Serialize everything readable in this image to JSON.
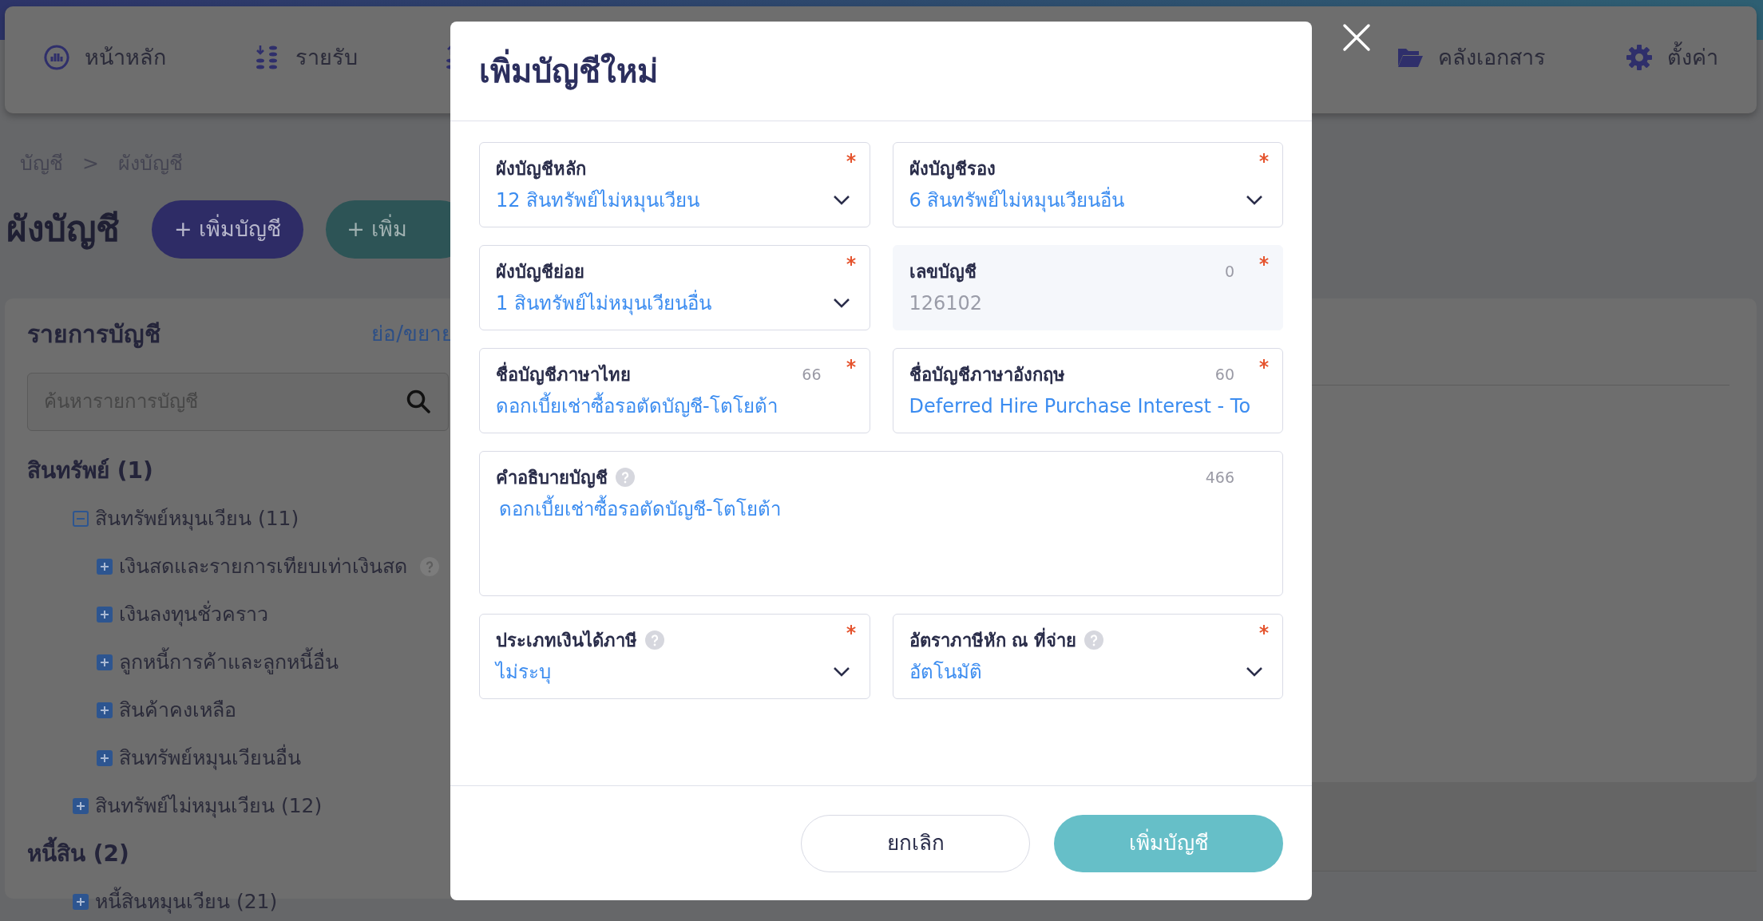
{
  "nav": {
    "left": [
      {
        "kind": "dashboard",
        "label": "หน้าหลัก"
      },
      {
        "kind": "income",
        "label": "รายรับ"
      },
      {
        "kind": "expense"
      }
    ],
    "right": [
      {
        "kind": "documents",
        "label": "คลังเอกสาร"
      },
      {
        "kind": "settings",
        "label": "ตั้งค่า"
      }
    ]
  },
  "breadcrumb": [
    "บัญชี",
    ">",
    "ผังบัญชี"
  ],
  "page_title": "ผังบัญชี",
  "actions": [
    {
      "kind": "primary",
      "label": "+ เพิ่มบัญชี"
    },
    {
      "kind": "secondary",
      "label": "+ เพิ่ม"
    }
  ],
  "account_list": {
    "title": "รายการบัญชี",
    "toggle": "ย่อ/ขยาย",
    "search": {
      "placeholder": "ค้นหารายการบัญชี"
    },
    "tree": [
      {
        "label": "สินทรัพย์ (1)",
        "children": [
          {
            "label": "สินทรัพย์หมุนเวียน (11)",
            "expanded": true,
            "children": [
              {
                "label": "เงินสดและรายการเทียบเท่าเงินสด",
                "expanded": false,
                "help": true
              },
              {
                "label": "เงินลงทุนชั่วคราว",
                "expanded": false,
                "help": false
              },
              {
                "label": "ลูกหนี้การค้าและลูกหนี้อื่น",
                "expanded": false,
                "help": false
              },
              {
                "label": "สินค้าคงเหลือ",
                "expanded": false,
                "help": false
              },
              {
                "label": "สินทรัพย์หมุนเวียนอื่น",
                "expanded": false,
                "help": false
              }
            ]
          },
          {
            "label": "สินทรัพย์ไม่หมุนเวียน (12)",
            "expanded": false
          }
        ]
      },
      {
        "label": "หนี้สิน (2)",
        "children": [
          {
            "label": "หนี้สินหมุนเวียน (21)",
            "expanded": false
          }
        ]
      }
    ]
  },
  "modal": {
    "title": "เพิ่มบัญชีใหม่",
    "fields": [
      {
        "kind": "select",
        "label": "ผังบัญชีหลัก",
        "value": "12 สินทรัพย์ไม่หมุนเวียน",
        "required": true,
        "disabled": false,
        "help": false
      },
      {
        "kind": "select",
        "label": "ผังบัญชีรอง",
        "value": "6 สินทรัพย์ไม่หมุนเวียนอื่น",
        "required": true,
        "disabled": false,
        "help": false
      },
      {
        "kind": "select",
        "label": "ผังบัญชีย่อย",
        "value": "1 สินทรัพย์ไม่หมุนเวียนอื่น",
        "required": true,
        "disabled": false,
        "help": false
      },
      {
        "kind": "text",
        "label": "เลขบัญชี",
        "value": "126102",
        "counter": "0",
        "required": true,
        "disabled": true,
        "help": false
      },
      {
        "kind": "text",
        "label": "ชื่อบัญชีภาษาไทย",
        "value": "ดอกเบี้ยเช่าซื้อรอตัดบัญชี-โตโยต้า",
        "counter": "66",
        "required": true,
        "disabled": false,
        "help": false
      },
      {
        "kind": "text",
        "label": "ชื่อบัญชีภาษาอังกฤษ",
        "value": "Deferred Hire Purchase Interest - To",
        "counter": "60",
        "required": true,
        "disabled": false,
        "help": false
      },
      {
        "kind": "textarea",
        "label": "คำอธิบายบัญชี",
        "value": "ดอกเบี้ยเช่าซื้อรอตัดบัญชี-โตโยต้า",
        "counter": "466",
        "required": false,
        "disabled": false,
        "help": true
      },
      {
        "kind": "select",
        "label": "ประเภทเงินได้ภาษี",
        "value": "ไม่ระบุ",
        "required": true,
        "disabled": false,
        "help": true
      },
      {
        "kind": "select",
        "label": "อัตราภาษีหัก ณ ที่จ่าย",
        "value": "อัตโนมัติ",
        "required": true,
        "disabled": false,
        "help": true
      }
    ],
    "buttons": [
      {
        "kind": "cancel",
        "label": "ยกเลิก"
      },
      {
        "kind": "submit",
        "label": "เพิ่มบัญชี"
      }
    ]
  }
}
